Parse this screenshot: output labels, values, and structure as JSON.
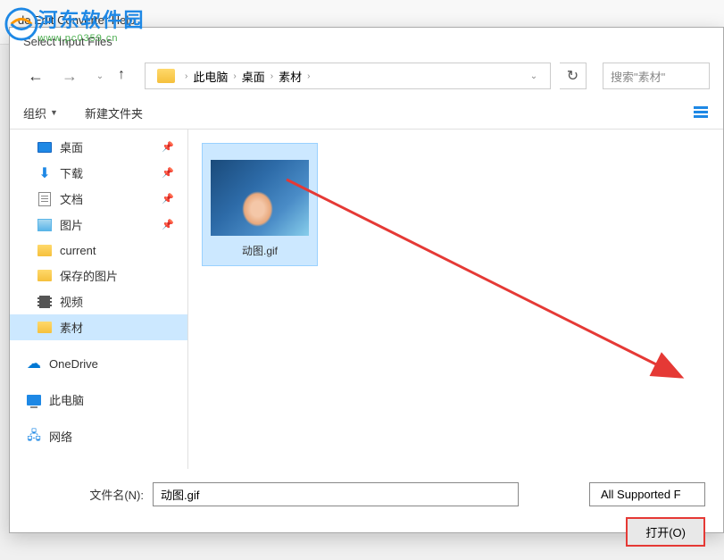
{
  "watermark": {
    "title": "河东软件园",
    "url": "www.pc0359.cn"
  },
  "background_menu": "de   Edit   Converter   Help",
  "dialog": {
    "title": "Select Input Files",
    "breadcrumb": {
      "items": [
        "此电脑",
        "桌面",
        "素材"
      ]
    },
    "search": {
      "placeholder": "搜索\"素材\""
    },
    "toolbar": {
      "organize": "组织",
      "new_folder": "新建文件夹"
    },
    "sidebar": {
      "items": [
        {
          "label": "桌面",
          "icon": "desktop",
          "pinned": true
        },
        {
          "label": "下载",
          "icon": "download",
          "pinned": true
        },
        {
          "label": "文档",
          "icon": "doc",
          "pinned": true
        },
        {
          "label": "图片",
          "icon": "pic",
          "pinned": true
        },
        {
          "label": "current",
          "icon": "folder",
          "pinned": false
        },
        {
          "label": "保存的图片",
          "icon": "folder",
          "pinned": false
        },
        {
          "label": "视频",
          "icon": "video",
          "pinned": false
        },
        {
          "label": "素材",
          "icon": "folder",
          "pinned": false,
          "selected": true
        },
        {
          "label": "OneDrive",
          "icon": "onedrive",
          "pinned": false,
          "spaced": true
        },
        {
          "label": "此电脑",
          "icon": "pc",
          "pinned": false,
          "spaced": true
        },
        {
          "label": "网络",
          "icon": "network",
          "pinned": false,
          "spaced": true
        }
      ]
    },
    "files": [
      {
        "name": "动图.gif",
        "selected": true
      }
    ],
    "filename_label": "文件名(N):",
    "filename_value": "动图.gif",
    "filetype": "All Supported F",
    "open_button": "打开(O)"
  }
}
